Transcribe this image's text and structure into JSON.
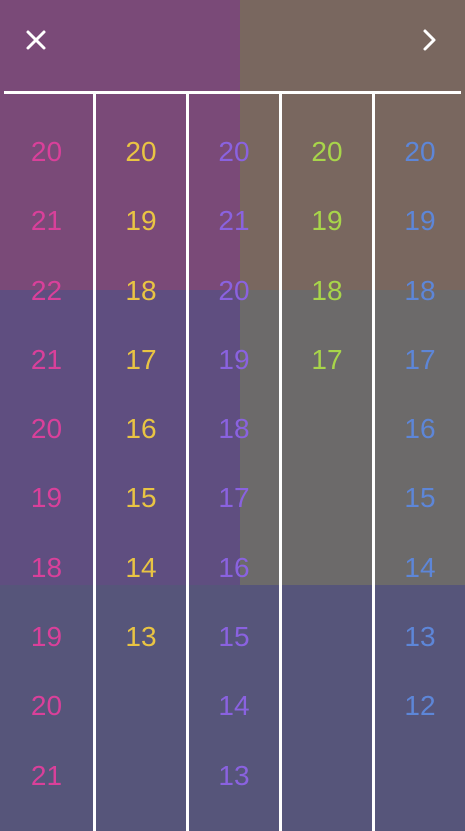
{
  "toolbar": {
    "close_icon": "close-icon",
    "next_icon": "chevron-right-icon"
  },
  "colors": {
    "divider": "#ffffff",
    "col1": "#d9409a",
    "col2": "#e9c443",
    "col3": "#8a62e0",
    "col4": "#a8d54a",
    "col5": "#5d86d8"
  },
  "columns": [
    {
      "values": [
        "20",
        "21",
        "22",
        "21",
        "20",
        "19",
        "18",
        "19",
        "20",
        "21"
      ]
    },
    {
      "values": [
        "20",
        "19",
        "18",
        "17",
        "16",
        "15",
        "14",
        "13"
      ]
    },
    {
      "values": [
        "20",
        "21",
        "20",
        "19",
        "18",
        "17",
        "16",
        "15",
        "14",
        "13"
      ]
    },
    {
      "values": [
        "20",
        "19",
        "18",
        "17"
      ]
    },
    {
      "values": [
        "20",
        "19",
        "18",
        "17",
        "16",
        "15",
        "14",
        "13",
        "12"
      ]
    }
  ]
}
